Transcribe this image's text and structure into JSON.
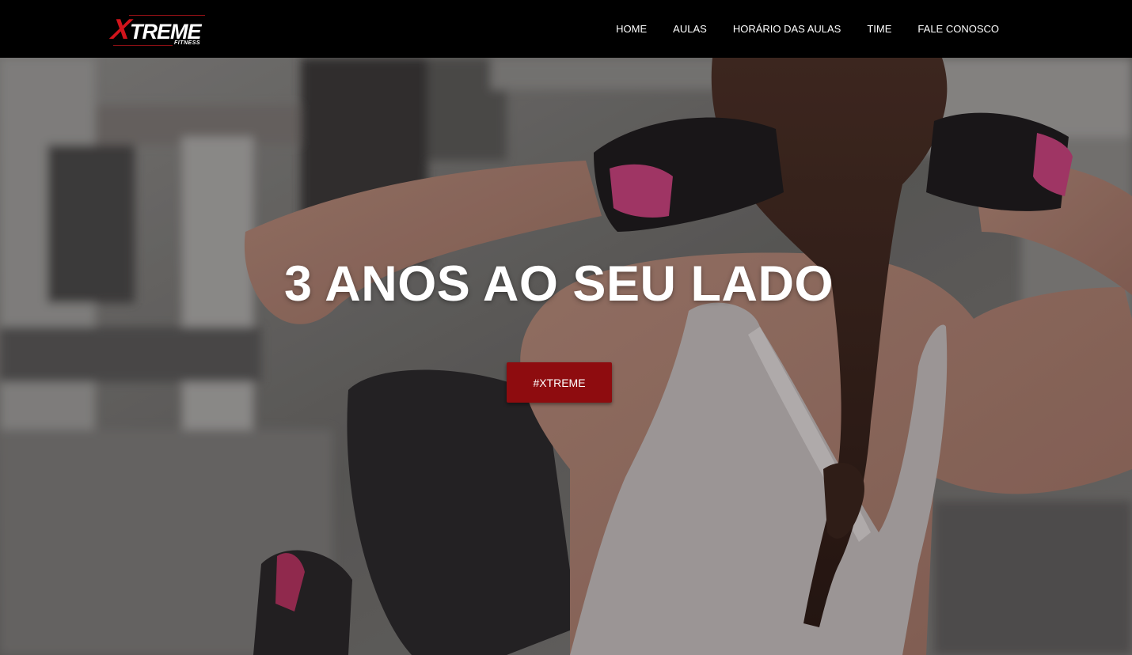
{
  "brand": {
    "logo_main_first": "X",
    "logo_main_rest": "TREME",
    "logo_sub": "FITNESS",
    "accent_color": "#d0141b"
  },
  "nav": {
    "items": [
      {
        "label": "HOME"
      },
      {
        "label": "AULAS"
      },
      {
        "label": "HORÁRIO DAS AULAS"
      },
      {
        "label": "TIME"
      },
      {
        "label": "FALE CONOSCO"
      }
    ]
  },
  "hero": {
    "title": "3 ANOS AO SEU LADO",
    "button_label": "#XTREME",
    "button_color": "#8e0c0f",
    "background_image": "woman-with-braid-in-gym-doing-sit-ups"
  }
}
